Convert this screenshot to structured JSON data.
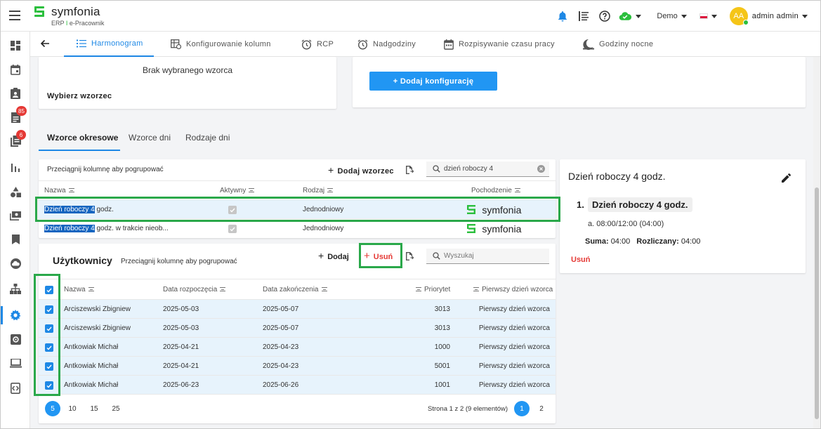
{
  "app": {
    "logo_name": "symfonia",
    "logo_sub_left": "ERP",
    "logo_sub_sep": "I",
    "logo_sub_right": "e-Pracownik"
  },
  "topbar": {
    "company": "Demo",
    "avatar_initials": "AA",
    "username": "admin admin"
  },
  "sidebar": {
    "badge_1": "85",
    "badge_2": "6"
  },
  "tabs": [
    {
      "label": "Harmonogram"
    },
    {
      "label": "Konfigurowanie kolumn"
    },
    {
      "label": "RCP"
    },
    {
      "label": "Nadgodziny"
    },
    {
      "label": "Rozpisywanie czasu pracy"
    },
    {
      "label": "Godziny nocne"
    }
  ],
  "pattern_card": {
    "no_pattern": "Brak wybranego wzorca",
    "choose_label": "Wybierz wzorzec"
  },
  "config_card": {
    "add_config_label": "+ Dodaj konfigurację"
  },
  "subtabs": [
    {
      "label": "Wzorce okresowe"
    },
    {
      "label": "Wzorce dni"
    },
    {
      "label": "Rodzaje dni"
    }
  ],
  "patterns_grid": {
    "group_hint": "Przeciągnij kolumnę aby pogrupować",
    "add_pattern": "Dodaj wzorzec",
    "search_value": "dzień roboczy 4",
    "columns": [
      "Nazwa",
      "Aktywny",
      "Rodzaj",
      "Pochodzenie"
    ],
    "rows": [
      {
        "name_hl": "Dzień roboczy 4",
        "name_rest": " godz.",
        "type": "Jednodniowy",
        "origin": "symfonia"
      },
      {
        "name_hl": "Dzień roboczy 4",
        "name_rest": " godz. w trakcie nieob...",
        "type": "Jednodniowy",
        "origin": "symfonia"
      }
    ]
  },
  "users_grid": {
    "title": "Użytkownicy",
    "group_hint": "Przeciągnij kolumnę aby pogrupować",
    "add_label": "Dodaj",
    "remove_label": "Usuń",
    "search_placeholder": "Wyszukaj",
    "columns": [
      "Nazwa",
      "Data rozpoczęcia",
      "Data zakończenia",
      "Priorytet",
      "Pierwszy dzień wzorca"
    ],
    "rows": [
      {
        "name": "Arciszewski Zbigniew",
        "start": "2025-05-03",
        "end": "2025-05-07",
        "priority": "3013",
        "first_day": "Pierwszy dzień wzorca"
      },
      {
        "name": "Arciszewski Zbigniew",
        "start": "2025-05-03",
        "end": "2025-05-07",
        "priority": "3013",
        "first_day": "Pierwszy dzień wzorca"
      },
      {
        "name": "Antkowiak Michał",
        "start": "2025-04-21",
        "end": "2025-04-23",
        "priority": "1000",
        "first_day": "Pierwszy dzień wzorca"
      },
      {
        "name": "Antkowiak Michał",
        "start": "2025-04-21",
        "end": "2025-04-23",
        "priority": "5001",
        "first_day": "Pierwszy dzień wzorca"
      },
      {
        "name": "Antkowiak Michał",
        "start": "2025-06-23",
        "end": "2025-06-26",
        "priority": "1001",
        "first_day": "Pierwszy dzień wzorca"
      }
    ],
    "page_sizes": [
      "5",
      "10",
      "15",
      "25"
    ],
    "page_info": "Strona 1 z 2 (9 elementów)",
    "pages": [
      "1",
      "2"
    ]
  },
  "detail": {
    "title": "Dzień roboczy 4 godz.",
    "item_number": "1.",
    "item_title": "Dzień roboczy 4 godz.",
    "sub_item": "a. 08:00/12:00 (04:00)",
    "sum_label": "Suma:",
    "sum_value": "04:00",
    "counted_label": "Rozliczany:",
    "counted_value": "04:00",
    "remove_label": "Usuń"
  },
  "colors": {
    "accent": "#2196f3",
    "brand_green": "#2bbf3d",
    "highlight_green": "#2aa84a",
    "danger": "#e53935"
  }
}
